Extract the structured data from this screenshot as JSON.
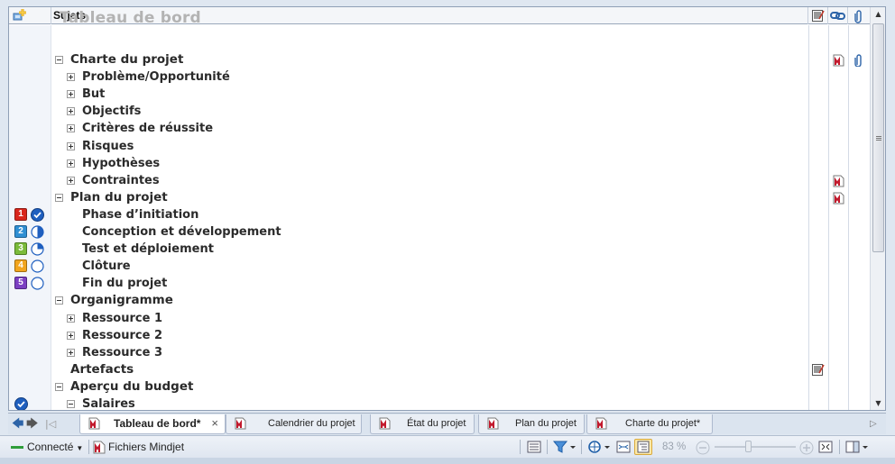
{
  "header": {
    "topic_col": "Sujets"
  },
  "central_topic": "Tableau de bord",
  "rows": [
    {
      "label": "Charte du projet",
      "level": 1,
      "toggle": "minus",
      "note": true,
      "attach": true
    },
    {
      "label": "Problème/Opportunité",
      "level": 2,
      "toggle": "plus"
    },
    {
      "label": "But",
      "level": 2,
      "toggle": "plus"
    },
    {
      "label": "Objectifs",
      "level": 2,
      "toggle": "plus"
    },
    {
      "label": "Critères de réussite",
      "level": 2,
      "toggle": "plus"
    },
    {
      "label": "Risques",
      "level": 2,
      "toggle": "plus"
    },
    {
      "label": "Hypothèses",
      "level": 2,
      "toggle": "plus"
    },
    {
      "label": "Contraintes",
      "level": 2,
      "toggle": "plus",
      "note": true
    },
    {
      "label": "Plan du projet",
      "level": 1,
      "toggle": "minus",
      "note": true
    },
    {
      "label": "Phase d’initiation",
      "level": 2,
      "toggle": "none",
      "priority": "1",
      "progress": "100"
    },
    {
      "label": "Conception et développement",
      "level": 2,
      "toggle": "none",
      "priority": "2",
      "progress": "50"
    },
    {
      "label": "Test et déploiement",
      "level": 2,
      "toggle": "none",
      "priority": "3",
      "progress": "25"
    },
    {
      "label": "Clôture",
      "level": 2,
      "toggle": "none",
      "priority": "4",
      "progress": "0"
    },
    {
      "label": "Fin du projet",
      "level": 2,
      "toggle": "none",
      "priority": "5",
      "progress": "0"
    },
    {
      "label": "Organigramme",
      "level": 1,
      "toggle": "minus"
    },
    {
      "label": "Ressource 1",
      "level": 2,
      "toggle": "plus"
    },
    {
      "label": "Ressource 2",
      "level": 2,
      "toggle": "plus"
    },
    {
      "label": "Ressource 3",
      "level": 2,
      "toggle": "plus"
    },
    {
      "label": "Artefacts",
      "level": 1,
      "toggle": "none",
      "notes_icon": true
    },
    {
      "label": "Aperçu du budget",
      "level": 1,
      "toggle": "minus"
    },
    {
      "label": "Salaires",
      "level": 2,
      "toggle": "minus",
      "progress": "100"
    }
  ],
  "tabs": [
    {
      "label": "Tableau de bord*",
      "active": true,
      "close": "×"
    },
    {
      "label": "Calendrier du projet"
    },
    {
      "label": "État du projet"
    },
    {
      "label": "Plan du projet"
    },
    {
      "label": "Charte du projet*"
    }
  ],
  "statusbar": {
    "connection": "Connecté",
    "files": "Fichiers Mindjet",
    "zoom": "83 %"
  },
  "colors": {
    "accent": "#2d64a8",
    "priority": [
      "#d9261c",
      "#2f8fd3",
      "#7bbb3a",
      "#f2a51d",
      "#7b3fc2"
    ]
  }
}
